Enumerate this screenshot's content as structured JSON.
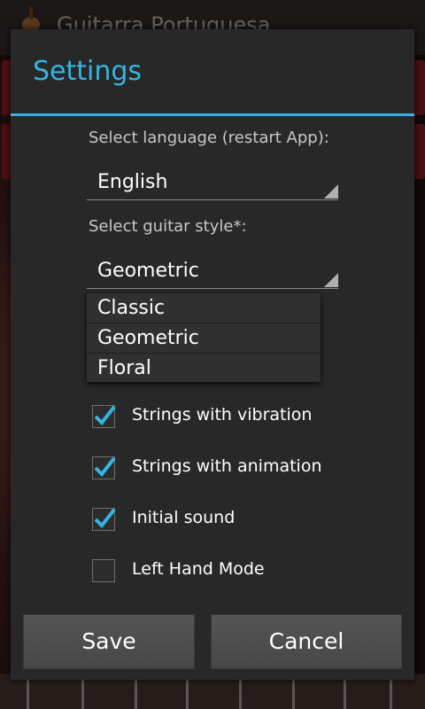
{
  "app": {
    "title": "Guitarra Portuguesa"
  },
  "dialog": {
    "title": "Settings",
    "language": {
      "label": "Select language (restart App):",
      "value": "English"
    },
    "guitar_style": {
      "label": "Select guitar style*:",
      "value": "Geometric",
      "options": [
        "Classic",
        "Geometric",
        "Floral"
      ]
    },
    "options": [
      {
        "label": "Strings with vibration",
        "checked": true
      },
      {
        "label": "Strings with animation",
        "checked": true
      },
      {
        "label": "Initial sound",
        "checked": true
      },
      {
        "label": "Left Hand Mode",
        "checked": false
      }
    ],
    "buttons": {
      "save": "Save",
      "cancel": "Cancel"
    }
  },
  "colors": {
    "accent": "#33b5e5",
    "dialog_bg": "#282828"
  }
}
